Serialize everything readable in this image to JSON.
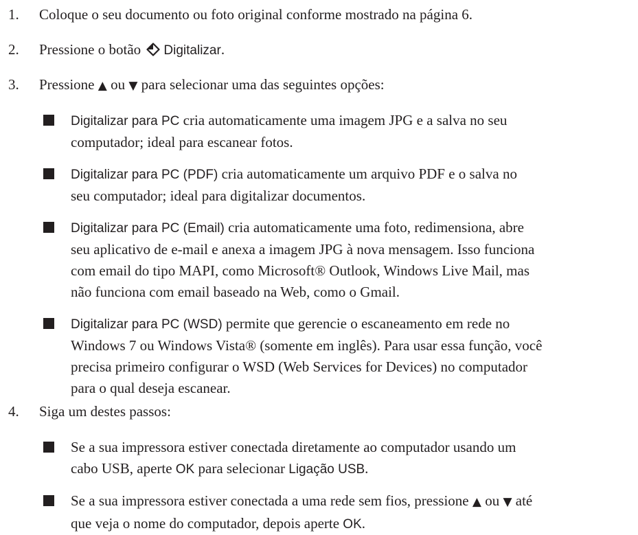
{
  "steps": [
    {
      "number": "1.",
      "text": "Coloque o seu documento ou foto original conforme mostrado na página 6."
    },
    {
      "number": "2.",
      "text_before": "Pressione o botão",
      "icon": "scan-diamond-icon",
      "button_label": "Digitalizar",
      "text_after": "."
    },
    {
      "number": "3.",
      "text_before": "Pressione",
      "up_arrow": "▲",
      "connector": "ou",
      "down_arrow": "▼",
      "text_after": "para selecionar uma das seguintes opções:",
      "options": [
        {
          "label": "Digitalizar para PC",
          "line1": "cria automaticamente uma imagem JPG e a salva no seu",
          "lines": [
            "computador; ideal para escanear fotos."
          ]
        },
        {
          "label": "Digitalizar para PC (PDF)",
          "line1": "cria automaticamente um arquivo PDF e o salva no",
          "lines": [
            "seu computador; ideal para digitalizar documentos."
          ]
        },
        {
          "label": "Digitalizar para PC (Email)",
          "line1": "cria automaticamente uma foto, redimensiona, abre",
          "lines": [
            "seu aplicativo de e-mail e anexa a imagem JPG à nova mensagem. Isso funciona",
            "com email do tipo MAPI, como Microsoft® Outlook, Windows Live Mail, mas",
            "não funciona com email baseado na Web, como o Gmail."
          ]
        },
        {
          "label": "Digitalizar para PC (WSD)",
          "line1": "permite que gerencie o escaneamento em rede no",
          "lines": [
            "Windows 7 ou Windows Vista® (somente em inglês). Para usar essa função, você",
            "precisa primeiro configurar o WSD (Web Services for Devices) no computador",
            "para o qual deseja escanear."
          ]
        }
      ]
    },
    {
      "number": "4.",
      "text": "Siga um destes passos:",
      "options": [
        {
          "line1": "Se a sua impressora estiver conectada diretamente ao computador usando um",
          "line2_before": "cabo USB, aperte",
          "ok_label": "OK",
          "line2_middle": "para selecionar",
          "usb_label": "Ligação USB",
          "line2_after": "."
        },
        {
          "line1_before": "Se a sua impressora estiver conectada a uma rede sem fios, pressione",
          "up_arrow": "▲",
          "connector": "ou",
          "down_arrow": "▼",
          "line1_after": "até",
          "line2_before": "que veja o nome do computador, depois aperte",
          "ok_label": "OK",
          "line2_after": "."
        }
      ]
    }
  ]
}
